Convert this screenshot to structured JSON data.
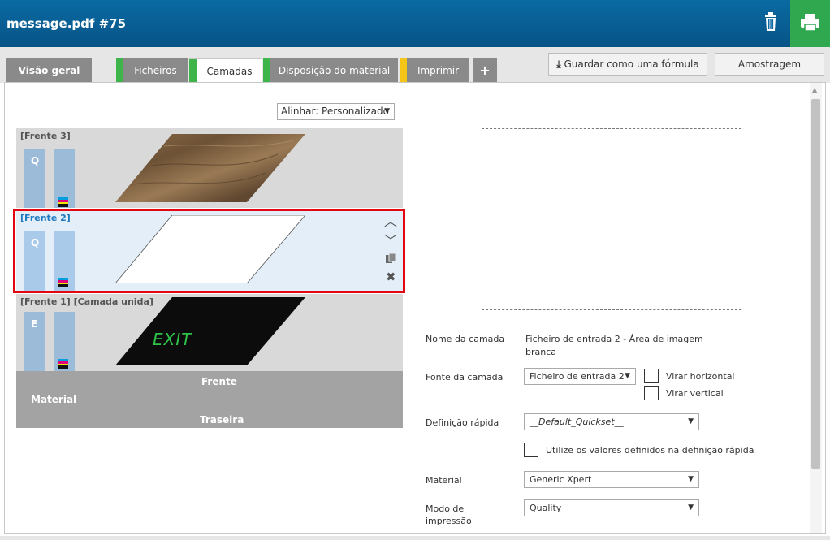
{
  "header": {
    "title": "message.pdf #75"
  },
  "tabs": [
    {
      "label": "Visão geral"
    },
    {
      "label": "Ficheiros"
    },
    {
      "label": "Camadas"
    },
    {
      "label": "Disposição do material"
    },
    {
      "label": "Imprimir"
    },
    {
      "label": "+"
    }
  ],
  "toolbar": {
    "formula_label": "Guardar como uma fórmula",
    "sample_label": "Amostragem"
  },
  "align": {
    "value": "Alinhar: Personalizado"
  },
  "layers": [
    {
      "label": "[Frente 3]",
      "bar_letter": "Q"
    },
    {
      "label": "[Frente 2]",
      "bar_letter": "Q"
    },
    {
      "label": "[Frente 1] [Camada unida]",
      "bar_letter": "E",
      "image_text": "EXIT"
    }
  ],
  "material": {
    "label": "Material",
    "front": "Frente",
    "back": "Traseira"
  },
  "form": {
    "layer_name_label": "Nome da camada",
    "layer_name_value_line1": "Ficheiro de entrada 2 - Área de imagem",
    "layer_name_value_line2": "branca",
    "source_label": "Fonte da camada",
    "source_value": "Ficheiro de entrada 2",
    "flip_h_label": "Virar horizontal",
    "flip_v_label": "Virar vertical",
    "quickset_label": "Definição rápida",
    "quickset_value": "__Default_Quickset__",
    "use_values_label": "Utilize os valores definidos na definição rápida",
    "material_label": "Material",
    "material_value": "Generic Xpert",
    "mode_label_line1": "Modo de",
    "mode_label_line2": "impressão",
    "mode_value": "Quality"
  },
  "colors": {
    "accent_blue": "#0a6aa3",
    "print_green": "#2fa84f",
    "selection_red": "#e30613",
    "tab_green": "#3db54a",
    "tab_yellow": "#f5c518"
  }
}
